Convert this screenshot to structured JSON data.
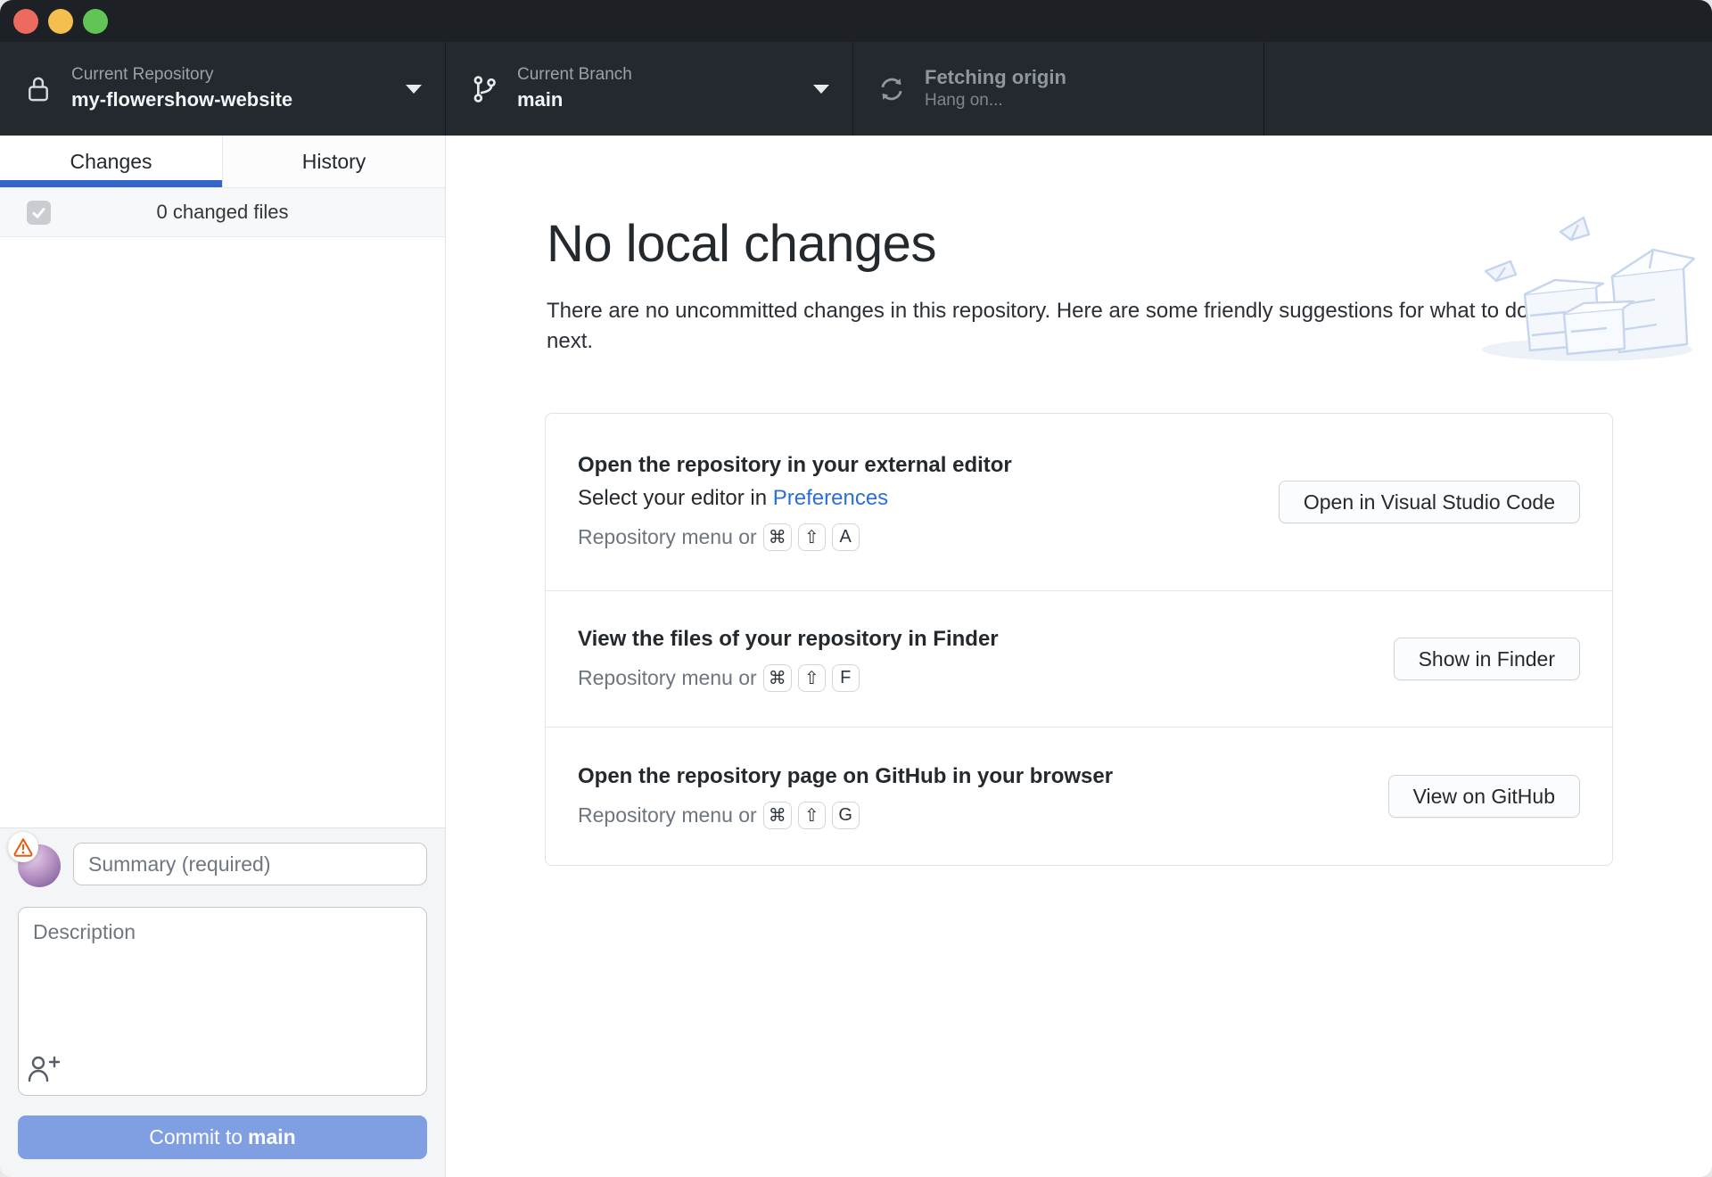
{
  "toolbar": {
    "repository": {
      "label": "Current Repository",
      "value": "my-flowershow-website"
    },
    "branch": {
      "label": "Current Branch",
      "value": "main"
    },
    "fetch": {
      "label": "Fetching origin",
      "status": "Hang on..."
    }
  },
  "sidebar": {
    "tabs": {
      "changes": "Changes",
      "history": "History"
    },
    "files_summary": "0 changed files",
    "commit": {
      "summary_placeholder": "Summary (required)",
      "description_placeholder": "Description",
      "commit_button_prefix": "Commit to",
      "commit_button_branch": "main"
    }
  },
  "main": {
    "heading": "No local changes",
    "subheading": "There are no uncommitted changes in this repository. Here are some friendly suggestions for what to do next.",
    "suggestions": [
      {
        "title": "Open the repository in your external editor",
        "subtitle_prefix": "Select your editor in ",
        "subtitle_link": "Preferences",
        "shortcut_label": "Repository menu or",
        "keys": [
          "⌘",
          "⇧",
          "A"
        ],
        "button": "Open in Visual Studio Code"
      },
      {
        "title": "View the files of your repository in Finder",
        "shortcut_label": "Repository menu or",
        "keys": [
          "⌘",
          "⇧",
          "F"
        ],
        "button": "Show in Finder"
      },
      {
        "title": "Open the repository page on GitHub in your browser",
        "shortcut_label": "Repository menu or",
        "keys": [
          "⌘",
          "⇧",
          "G"
        ],
        "button": "View on GitHub"
      }
    ]
  },
  "colors": {
    "titlebar": "#1d2126",
    "toolbar": "#24292f",
    "tab_accent_blue": "#3565c8",
    "link_blue": "#2d6fd8",
    "commit_button_blue": "#7f9fe2",
    "warning_orange": "#e8590c",
    "illustration_blue": "#c6d5ee"
  },
  "icons": {
    "checkmark": "✓",
    "chevron_down": "▾"
  }
}
